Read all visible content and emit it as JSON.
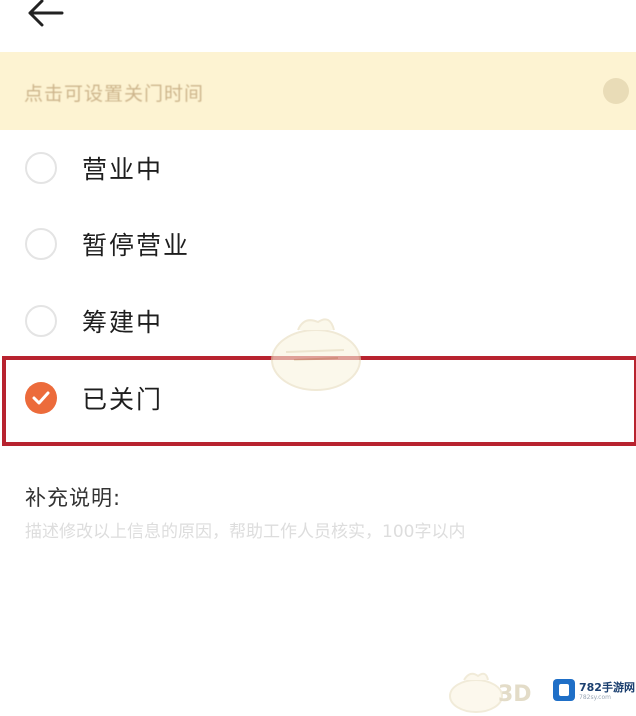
{
  "header": {
    "back_icon": "arrow-left-icon"
  },
  "notice": {
    "text": "点击可设置关门时间"
  },
  "status_options": [
    {
      "label": "营业中",
      "checked": false
    },
    {
      "label": "暂停营业",
      "checked": false
    },
    {
      "label": "筹建中",
      "checked": false
    },
    {
      "label": "已关门",
      "checked": true
    }
  ],
  "supplement": {
    "title": "补充说明:",
    "placeholder": "描述修改以上信息的原因，帮助工作人员核实，100字以内"
  },
  "watermark": {
    "text": "3D",
    "brand_name": "782手游网",
    "brand_url": "782sy.com"
  },
  "colors": {
    "accent": "#ec6b3b",
    "notice_bg": "#fdf3d2",
    "highlight_border": "#b8232f",
    "brand_blue": "#1f6fc7"
  }
}
